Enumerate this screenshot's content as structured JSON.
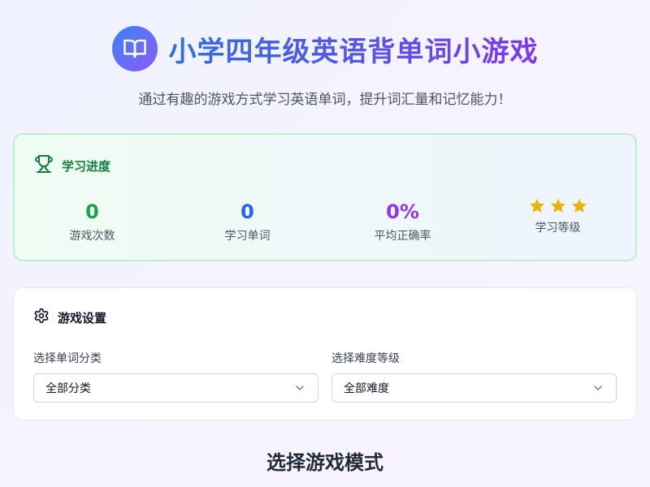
{
  "header": {
    "title": "小学四年级英语背单词小游戏",
    "subtitle": "通过有趣的游戏方式学习英语单词，提升词汇量和记忆能力！",
    "logo_icon": "book-icon"
  },
  "progress": {
    "title": "学习进度",
    "icon": "trophy-icon",
    "stats": [
      {
        "value": "0",
        "label": "游戏次数",
        "color": "#16a34a"
      },
      {
        "value": "0",
        "label": "学习单词",
        "color": "#2563eb"
      },
      {
        "value": "0%",
        "label": "平均正确率",
        "color": "#9333ea"
      }
    ],
    "level": {
      "label": "学习等级",
      "stars": 3,
      "star_color": "#eab308"
    }
  },
  "settings": {
    "title": "游戏设置",
    "icon": "gear-icon",
    "category": {
      "label": "选择单词分类",
      "value": "全部分类"
    },
    "difficulty": {
      "label": "选择难度等级",
      "value": "全部难度"
    }
  },
  "modes": {
    "title": "选择游戏模式"
  }
}
